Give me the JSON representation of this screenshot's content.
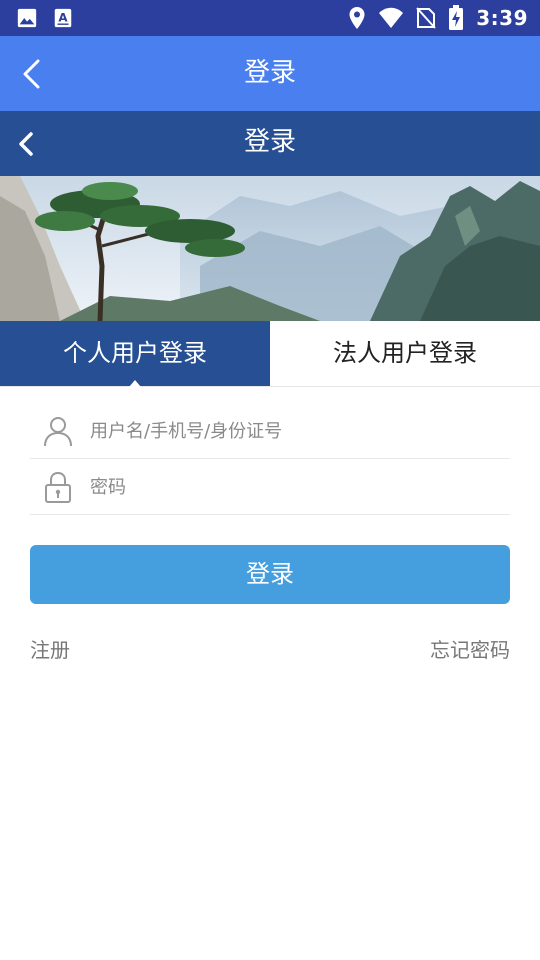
{
  "status_bar": {
    "time": "3:39",
    "left_icons": [
      "image-icon",
      "text-a-icon"
    ],
    "right_icons": [
      "location-icon",
      "wifi-icon",
      "no-sim-icon",
      "battery-charging-icon"
    ]
  },
  "app_bar": {
    "title": "登录",
    "back_icon": "chevron-left-icon",
    "color": "#4a7ff0"
  },
  "web_header": {
    "title": "登录",
    "back_icon": "chevron-left-icon",
    "color": "#274f93"
  },
  "banner": {
    "description_icon": "mountain-landscape-image"
  },
  "tabs": [
    {
      "label": "个人用户登录",
      "active": true
    },
    {
      "label": "法人用户登录",
      "active": false
    }
  ],
  "form": {
    "username": {
      "placeholder": "用户名/手机号/身份证号",
      "value": "",
      "icon": "user-icon"
    },
    "password": {
      "placeholder": "密码",
      "value": "",
      "icon": "lock-icon"
    },
    "submit_label": "登录",
    "button_color": "#459fdf"
  },
  "links": {
    "register": "注册",
    "forgot_password": "忘记密码"
  }
}
